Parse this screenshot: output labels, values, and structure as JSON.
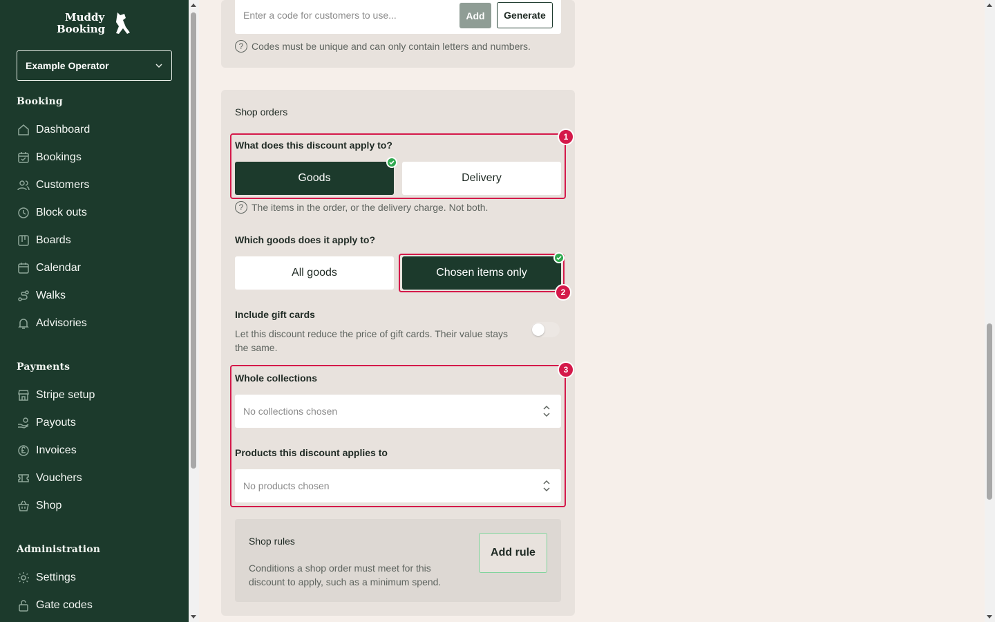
{
  "sidebar": {
    "operator": "Example Operator",
    "sections": [
      {
        "title": "Booking",
        "items": [
          "Dashboard",
          "Bookings",
          "Customers",
          "Block outs",
          "Boards",
          "Calendar",
          "Walks",
          "Advisories"
        ]
      },
      {
        "title": "Payments",
        "items": [
          "Stripe setup",
          "Payouts",
          "Invoices",
          "Vouchers",
          "Shop"
        ]
      },
      {
        "title": "Administration",
        "items": [
          "Settings",
          "Gate codes"
        ]
      }
    ]
  },
  "code": {
    "placeholder": "Enter a code for customers to use...",
    "add_label": "Add",
    "generate_label": "Generate",
    "hint": "Codes must be unique and can only contain letters and numbers."
  },
  "shop": {
    "title": "Shop orders",
    "apply_question": "What does this discount apply to?",
    "apply_options": [
      "Goods",
      "Delivery"
    ],
    "apply_selected": "Goods",
    "apply_hint": "The items in the order, or the delivery charge. Not both.",
    "goods_question": "Which goods does it apply to?",
    "goods_options": [
      "All goods",
      "Chosen items only"
    ],
    "goods_selected": "Chosen items only",
    "gift_title": "Include gift cards",
    "gift_desc": "Let this discount reduce the price of gift cards. Their value stays the same.",
    "gift_enabled": false,
    "collections_label": "Whole collections",
    "collections_placeholder": "No collections chosen",
    "products_label": "Products this discount applies to",
    "products_placeholder": "No products chosen",
    "rules_title": "Shop rules",
    "rules_desc": "Conditions a shop order must meet for this discount to apply, such as a minimum spend.",
    "add_rule_label": "Add rule"
  },
  "annotations": [
    "1",
    "2",
    "3"
  ],
  "colors": {
    "sidebar": "#1c3a2c",
    "accent": "#d4194a",
    "selected": "#1c3a2c",
    "check": "#2fa84f"
  }
}
